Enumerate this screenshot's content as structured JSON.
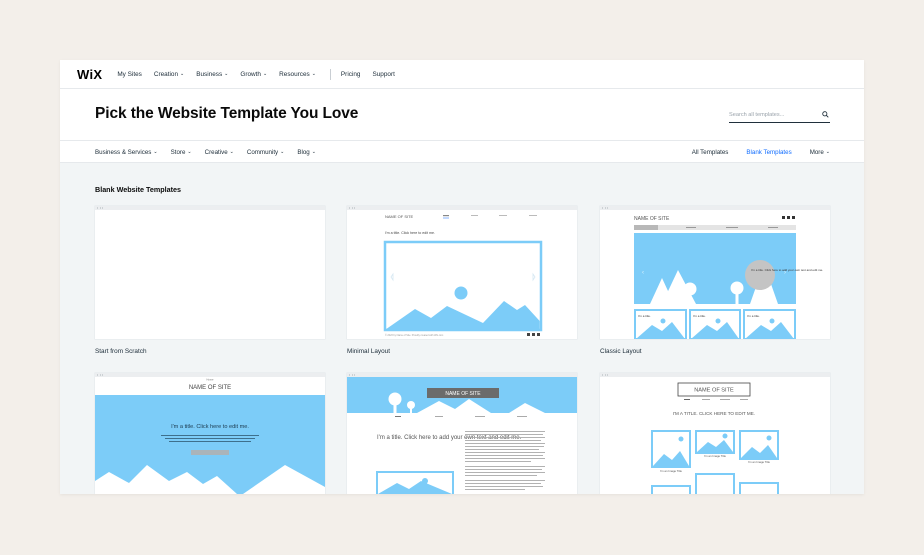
{
  "nav": {
    "logo": "WiX",
    "items": [
      {
        "label": "My Sites",
        "dropdown": false
      },
      {
        "label": "Creation",
        "dropdown": true
      },
      {
        "label": "Business",
        "dropdown": true
      },
      {
        "label": "Growth",
        "dropdown": true
      },
      {
        "label": "Resources",
        "dropdown": true
      }
    ],
    "pricing": "Pricing",
    "support": "Support"
  },
  "header": {
    "title": "Pick the Website Template You Love",
    "search_placeholder": "Search all templates..."
  },
  "subnav": {
    "categories": [
      "Business & Services",
      "Store",
      "Creative",
      "Community",
      "Blog"
    ],
    "all_templates": "All Templates",
    "blank_templates": "Blank Templates",
    "more": "More"
  },
  "section": {
    "title": "Blank Website Templates"
  },
  "templates": [
    {
      "name": "Start from Scratch"
    },
    {
      "name": "Minimal Layout"
    },
    {
      "name": "Classic Layout"
    },
    {
      "name": ""
    },
    {
      "name": ""
    },
    {
      "name": ""
    }
  ],
  "thumbs": {
    "minimal": {
      "site_name": "NAME OF SITE",
      "title": "I'm a title. Click here to edit me.",
      "footer": "© 2023 by Name of Site. Proudly created with Wix.com"
    },
    "classic": {
      "site_name": "NAME OF SITE",
      "bubble": "I'm a title. Click here to add your own text and edit me.",
      "box_title": "I'm a title."
    },
    "t4": {
      "site_name": "NAME OF SITE",
      "home": "Home",
      "title": "I'm a title. Click here to edit me."
    },
    "t5": {
      "site_name": "NAME OF SITE",
      "title": "I'm a title. Click here to add your own text and edit me."
    },
    "t6": {
      "site_name": "NAME OF SITE",
      "title": "I'M A TITLE. CLICK HERE TO EDIT ME.",
      "caption": "I'm an Image Title"
    }
  },
  "colors": {
    "accent": "#116dff",
    "sky": "#7cccf8",
    "background": "#f3efea",
    "panel": "#f2f5f6"
  }
}
